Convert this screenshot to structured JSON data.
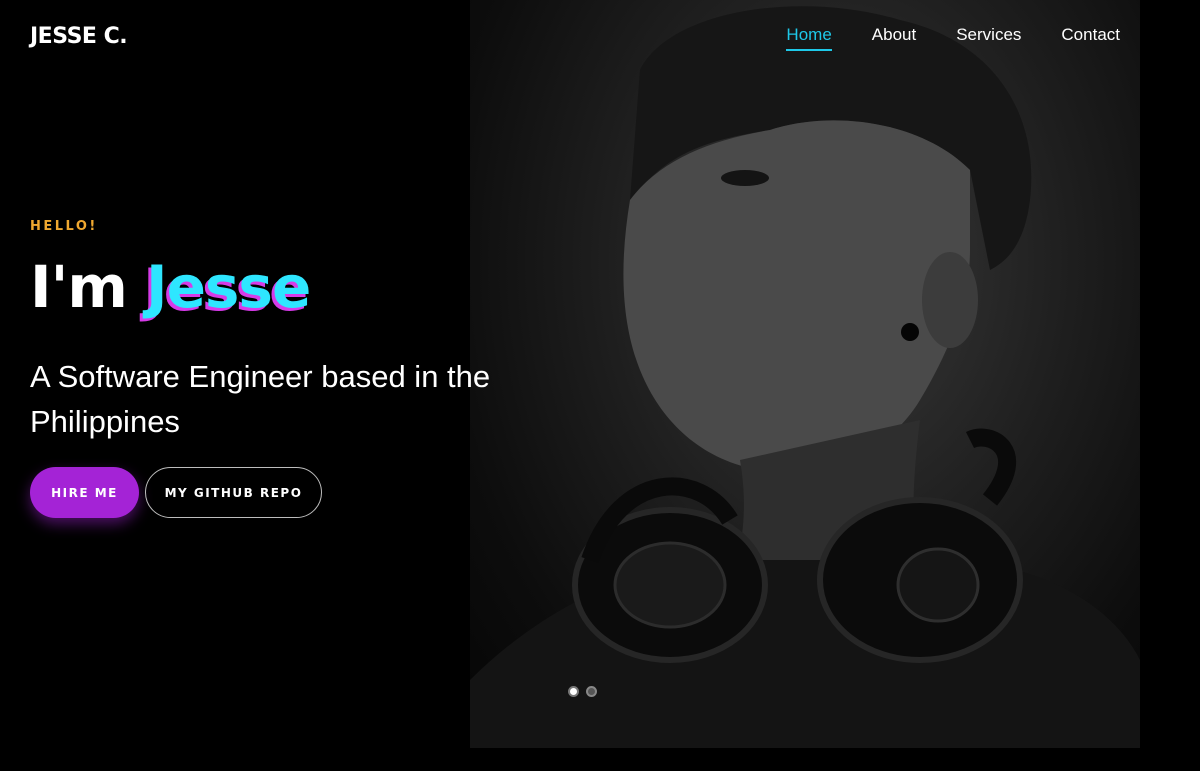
{
  "header": {
    "brand": "JESSE C.",
    "nav": [
      {
        "label": "Home",
        "active": true
      },
      {
        "label": "About",
        "active": false
      },
      {
        "label": "Services",
        "active": false
      },
      {
        "label": "Contact",
        "active": false
      }
    ]
  },
  "hero": {
    "eyebrow": "HELLO!",
    "title_prefix": "I'm",
    "title_name": "Jesse",
    "subtitle": "A Software Engineer based in the Philippines",
    "buttons": {
      "hire": "HIRE ME",
      "repo": "MY GITHUB REPO"
    },
    "carousel": {
      "slides": 2,
      "active_index": 0
    }
  },
  "colors": {
    "accent": "#1ec8e8",
    "eyebrow": "#f0a830",
    "name": "#2ee6ff",
    "name_shadow": "#d63be8",
    "button_primary": "#a423d6",
    "background": "#000000"
  }
}
